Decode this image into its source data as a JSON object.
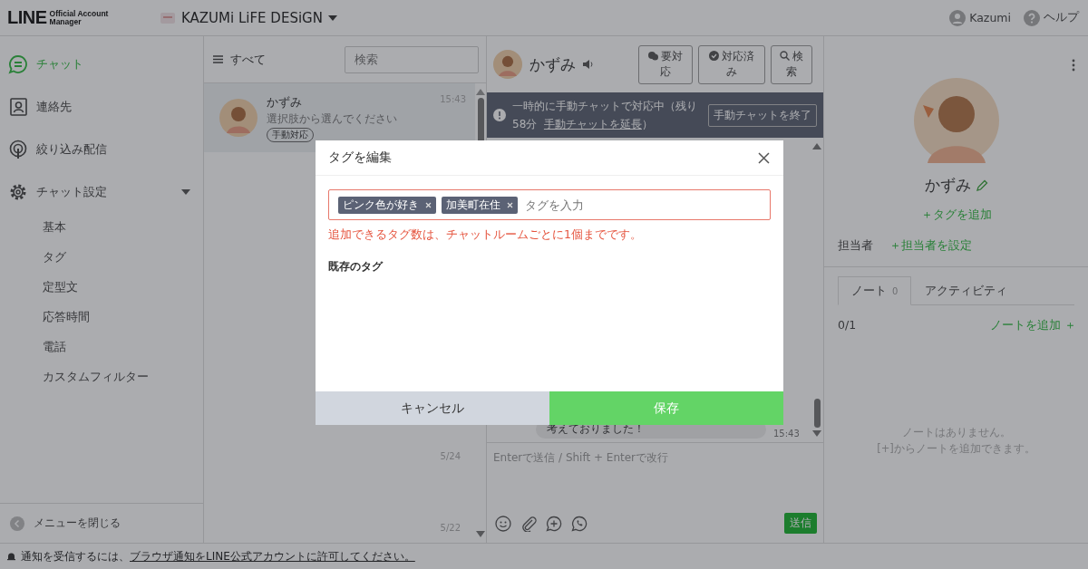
{
  "header": {
    "logo": "LINE",
    "logo_sub": [
      "Official Account",
      "Manager"
    ],
    "account_name": "KAZUMi LiFE DESiGN",
    "user": "Kazumi",
    "help": "ヘルプ"
  },
  "sidebar": {
    "items": [
      {
        "label": "チャット",
        "kind": "chat",
        "selected": true
      },
      {
        "label": "連絡先",
        "kind": "contacts",
        "selected": false
      },
      {
        "label": "絞り込み配信",
        "kind": "broadcast",
        "selected": false
      },
      {
        "label": "チャット設定",
        "kind": "settings",
        "selected": false,
        "expanded": true,
        "children": [
          {
            "label": "基本"
          },
          {
            "label": "タグ"
          },
          {
            "label": "定型文"
          },
          {
            "label": "応答時間"
          },
          {
            "label": "電話"
          },
          {
            "label": "カスタムフィルター"
          }
        ]
      }
    ],
    "collapse": "メニューを閉じる"
  },
  "chat_list": {
    "filter": "すべて",
    "search": {
      "placeholder": "検索"
    },
    "conversations": [
      {
        "name": "かずみ",
        "preview": "選択肢から選んでください",
        "time": "15:43",
        "tag": "手動対応",
        "selected": true
      }
    ],
    "other_times": [
      "5/24",
      "5/22"
    ]
  },
  "chat": {
    "name": "かずみ",
    "buttons": [
      {
        "label": "要対応",
        "kind": "flag"
      },
      {
        "label": "対応済み",
        "kind": "done"
      },
      {
        "label": "検索",
        "kind": "search"
      }
    ],
    "banner": {
      "text": "一時的に手動チャットで対応中（残り58分",
      "link": "手動チャットを延長",
      "text_end": "）",
      "button": "手動チャットを終了"
    },
    "message": {
      "text": "考えておりました！",
      "time": "15:43"
    },
    "composer": {
      "placeholder": "Enterで送信 / Shift + Enterで改行",
      "send": "送信"
    }
  },
  "profile": {
    "name": "かずみ",
    "add_tag": "＋タグを追加",
    "assignee_label": "担当者",
    "assignee_set": "＋担当者を設定",
    "tabs": [
      {
        "label": "ノート",
        "count": "0",
        "selected": true
      },
      {
        "label": "アクティビティ",
        "selected": false
      }
    ],
    "note_count": "0/1",
    "add_note": "ノートを追加 ＋",
    "empty": [
      "ノートはありません。",
      "[+]からノートを追加できます。"
    ]
  },
  "footer": {
    "text": "通知を受信するには、",
    "link": "ブラウザ通知をLINE公式アカウントに許可してください。"
  },
  "modal": {
    "title": "タグを編集",
    "tags": [
      "ピンク色が好き",
      "加美町在住"
    ],
    "placeholder": "タグを入力",
    "invalid": true,
    "error": "追加できるタグ数は、チャットルームごとに1個までです。",
    "section": "既存のタグ",
    "cancel": "キャンセル",
    "save": "保存"
  }
}
